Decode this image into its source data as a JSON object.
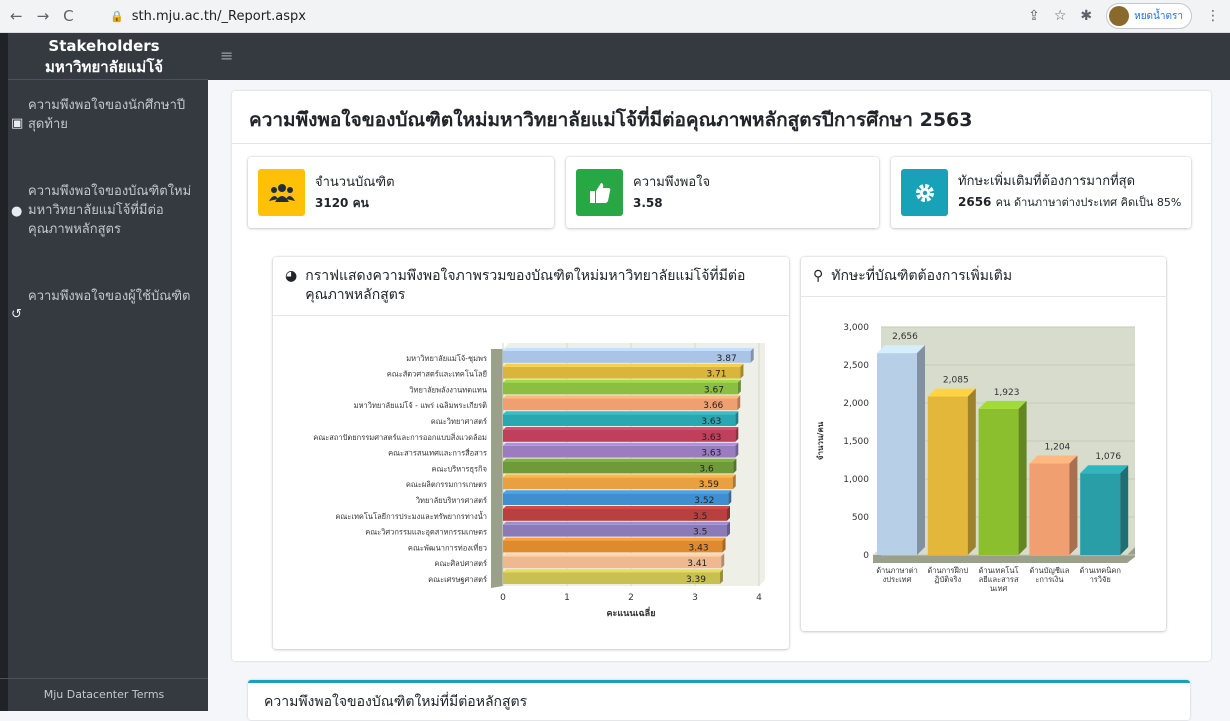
{
  "browser": {
    "url": "sth.mju.ac.th/_Report.aspx",
    "profile_name": "หยดน้ำตรา"
  },
  "sidebar": {
    "brand_line1": "Stakeholders",
    "brand_line2": "มหาวิทยาลัยแม่โจ้",
    "items": [
      {
        "label": "ความพึงพอใจของนักศึกษาปีสุดท้าย",
        "icon": "id-card-icon"
      },
      {
        "label": "ความพึงพอใจของบัณฑิตใหม่มหาวิทยาลัยแม่โจ้ที่มีต่อคุณภาพหลักสูตร",
        "icon": "user-icon"
      },
      {
        "label": "ความพึงพอใจของผู้ใช้บัณฑิต",
        "icon": "history-icon"
      }
    ],
    "footer": "Mju Datacenter Terms"
  },
  "page": {
    "title": "ความพึงพอใจของบัณฑิตใหม่มหาวิทยาลัยแม่โจ้ที่มีต่อคุณภาพหลักสูตรปีการศึกษา 2563",
    "info": [
      {
        "label": "จำนวนบัณฑิต",
        "value": "3120 คน",
        "extra": "",
        "color": "#ffc107",
        "icon": "users-icon"
      },
      {
        "label": "ความพึงพอใจ",
        "value": "3.58",
        "extra": "",
        "color": "#28a745",
        "icon": "thumbs-up-icon"
      },
      {
        "label": "ทักษะเพิ่มเติมที่ต้องการมากที่สุด",
        "value": "2656",
        "extra": "คน ด้านภาษาต่างประเทศ คิดเป็น 85%",
        "color": "#17a2b8",
        "icon": "gear-icon"
      }
    ],
    "left_panel_title": "กราฟแสดงความพึงพอใจภาพรวมของบัณฑิตใหม่มหาวิทยาลัยแม่โจ้ที่มีต่อคุณภาพหลักสูตร",
    "right_panel_title": "ทักษะที่บัณฑิตต้องการเพิ่มเติม",
    "bottom_title": "ความพึงพอใจของบัณฑิตใหม่ที่มีต่อหลักสูตร"
  },
  "chart_data": [
    {
      "type": "bar",
      "orientation": "horizontal",
      "xlabel": "คะแนนเฉลี่ย",
      "xlim": [
        0,
        4
      ],
      "xticks": [
        "0",
        "1",
        "2",
        "3",
        "4"
      ],
      "categories": [
        "มหาวิทยาลัยแม่โจ้-ชุมพร",
        "คณะสัตวศาสตร์และเทคโนโลยี",
        "วิทยาลัยพลังงานทดแทน",
        "มหาวิทยาลัยแม่โจ้ - แพร่ เฉลิมพระเกียรติ",
        "คณะวิทยาศาสตร์",
        "คณะสถาปัตยกรรมศาสตร์และการออกแบบสิ่งแวดล้อม",
        "คณะสารสนเทศและการสื่อสาร",
        "คณะบริหารธุรกิจ",
        "คณะผลิตกรรมการเกษตร",
        "วิทยาลัยบริหารศาสตร์",
        "คณะเทคโนโลยีการประมงและทรัพยากรทางน้ำ",
        "คณะวิศวกรรมและอุตสาหกรรมเกษตร",
        "คณะพัฒนาการท่องเที่ยว",
        "คณะศิลปศาสตร์",
        "คณะเศรษฐศาสตร์"
      ],
      "values": [
        3.87,
        3.71,
        3.67,
        3.66,
        3.63,
        3.63,
        3.63,
        3.6,
        3.59,
        3.52,
        3.5,
        3.5,
        3.43,
        3.41,
        3.39
      ],
      "value_labels": [
        "3.87",
        "3.71",
        "3.67",
        "3.66",
        "3.63",
        "3.63",
        "3.63",
        "3.6",
        "3.59",
        "3.52",
        "3.5",
        "3.5",
        "3.43",
        "3.41",
        "3.39"
      ],
      "colors": [
        "#a9c4e6",
        "#d9b53a",
        "#8bbf3f",
        "#f0a070",
        "#2aa8b2",
        "#c0405c",
        "#9b7cc0",
        "#6f9a3a",
        "#e8a040",
        "#3f8fd0",
        "#b8403e",
        "#8a7ab8",
        "#e08a30",
        "#f0b890",
        "#c8c050"
      ]
    },
    {
      "type": "bar",
      "orientation": "vertical",
      "ylabel": "จำนวน/คน",
      "ylim": [
        0,
        3000
      ],
      "yticks": [
        "0",
        "500",
        "1,000",
        "1,500",
        "2,000",
        "2,500",
        "3,000"
      ],
      "categories": [
        "ด้านภาษาต่างประเทศ",
        "ด้านการฝึกปฏิบัติจริง",
        "ด้านเทคโนโลยีและสารสนเทศ",
        "ด้านบัญชีและการเงิน",
        "ด้านเทคนิคการวิจัย"
      ],
      "category_lines": [
        [
          "ด้านภาษาต่า",
          "งประเทศ"
        ],
        [
          "ด้านการฝึกป",
          "ฏิบัติจริง"
        ],
        [
          "ด้านเทคโนโ",
          "ลยีและสารส",
          "นเทศ"
        ],
        [
          "ด้านบัญชีแล",
          "ะการเงิน"
        ],
        [
          "ด้านเทคนิคก",
          "ารวิจัย"
        ]
      ],
      "values": [
        2656,
        2085,
        1923,
        1204,
        1076
      ],
      "value_labels": [
        "2,656",
        "2,085",
        "1,923",
        "1,204",
        "1,076"
      ],
      "colors": [
        "#b8cfe8",
        "#e3b83a",
        "#8cbf2e",
        "#f0a070",
        "#2a9ea6"
      ]
    }
  ]
}
